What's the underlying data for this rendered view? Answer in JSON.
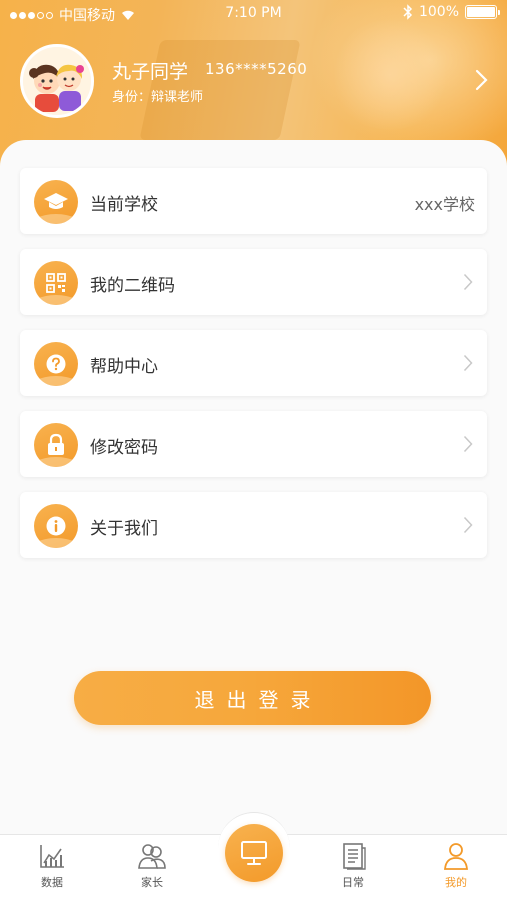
{
  "status_bar": {
    "carrier": "中国移动",
    "time": "7:10 PM",
    "battery": "100%"
  },
  "profile": {
    "name": "丸子同学",
    "phone": "136****5260",
    "role": "身份：辩课老师"
  },
  "menu": [
    {
      "label": "当前学校",
      "value": "xxx学校",
      "icon": "graduation-cap-icon"
    },
    {
      "label": "我的二维码",
      "icon": "qr-code-icon"
    },
    {
      "label": "帮助中心",
      "icon": "question-icon"
    },
    {
      "label": "修改密码",
      "icon": "lock-icon"
    },
    {
      "label": "关于我们",
      "icon": "info-icon"
    }
  ],
  "logout_label": "退出登录",
  "tabbar": {
    "tabs": [
      {
        "label": "数据",
        "icon": "chart-icon"
      },
      {
        "label": "家长",
        "icon": "parents-icon"
      },
      {
        "label": "",
        "icon": "monitor-icon"
      },
      {
        "label": "日常",
        "icon": "document-icon"
      },
      {
        "label": "我的",
        "icon": "person-icon"
      }
    ],
    "active_color": "#f39a2a"
  },
  "colors": {
    "accent": "#f39a2a",
    "header_gradient_start": "#f6b24a"
  }
}
